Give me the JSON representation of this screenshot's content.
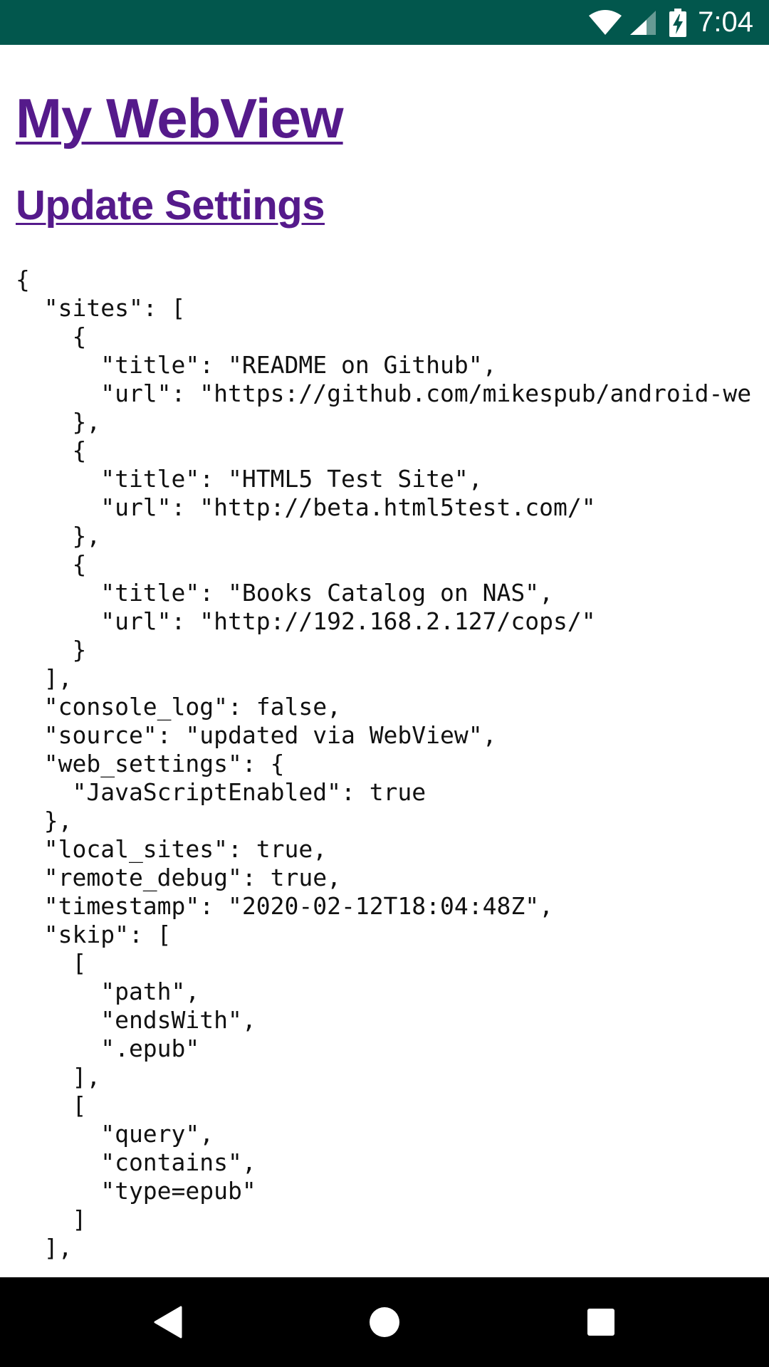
{
  "status_bar": {
    "time": "7:04",
    "icons": [
      "wifi-icon",
      "signal-icon",
      "battery-charging-icon"
    ],
    "background_color": "#02574d"
  },
  "page": {
    "title": "My WebView",
    "settings_link": "Update Settings",
    "link_color": "#551a8b",
    "json_lines": [
      "{",
      "  \"sites\": [",
      "    {",
      "      \"title\": \"README on Github\",",
      "      \"url\": \"https://github.com/mikespub/android-we",
      "    },",
      "    {",
      "      \"title\": \"HTML5 Test Site\",",
      "      \"url\": \"http://beta.html5test.com/\"",
      "    },",
      "    {",
      "      \"title\": \"Books Catalog on NAS\",",
      "      \"url\": \"http://192.168.2.127/cops/\"",
      "    }",
      "  ],",
      "  \"console_log\": false,",
      "  \"source\": \"updated via WebView\",",
      "  \"web_settings\": {",
      "    \"JavaScriptEnabled\": true",
      "  },",
      "  \"local_sites\": true,",
      "  \"remote_debug\": true,",
      "  \"timestamp\": \"2020-02-12T18:04:48Z\",",
      "  \"skip\": [",
      "    [",
      "      \"path\",",
      "      \"endsWith\",",
      "      \".epub\"",
      "    ],",
      "    [",
      "      \"query\",",
      "      \"contains\",",
      "      \"type=epub\"",
      "    ]",
      "  ],"
    ]
  },
  "nav_bar": {
    "buttons": [
      "back-icon",
      "home-icon",
      "recent-apps-icon"
    ]
  }
}
